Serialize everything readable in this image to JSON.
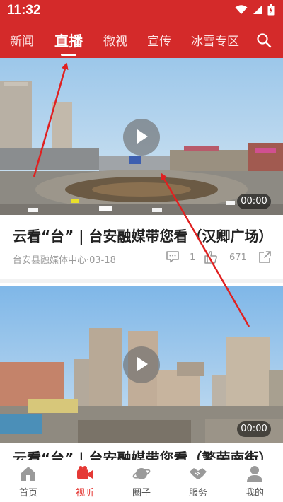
{
  "status_bar": {
    "time": "11:32"
  },
  "tabs": [
    {
      "label": "新闻",
      "active": false
    },
    {
      "label": "直播",
      "active": true
    },
    {
      "label": "微视",
      "active": false
    },
    {
      "label": "宣传",
      "active": false
    },
    {
      "label": "冰雪专区",
      "active": false
    }
  ],
  "feed": [
    {
      "title": "云看“台” | 台安融媒带您看（汉卿广场）",
      "source": "台安县融媒体中心·03-18",
      "comments": "1",
      "likes": "671",
      "duration": "00:00"
    },
    {
      "title": "云看“台” | 台安融媒带您看（繁荣南街）",
      "duration": "00:00"
    }
  ],
  "bottom_nav": [
    {
      "label": "首页",
      "icon": "home-icon",
      "active": false
    },
    {
      "label": "视听",
      "icon": "video-icon",
      "active": true
    },
    {
      "label": "圈子",
      "icon": "planet-icon",
      "active": false
    },
    {
      "label": "服务",
      "icon": "handshake-icon",
      "active": false
    },
    {
      "label": "我的",
      "icon": "user-icon",
      "active": false
    }
  ],
  "colors": {
    "brand": "#d42a2a",
    "active_nav": "#e53935",
    "annotation_arrow": "#e02020"
  }
}
